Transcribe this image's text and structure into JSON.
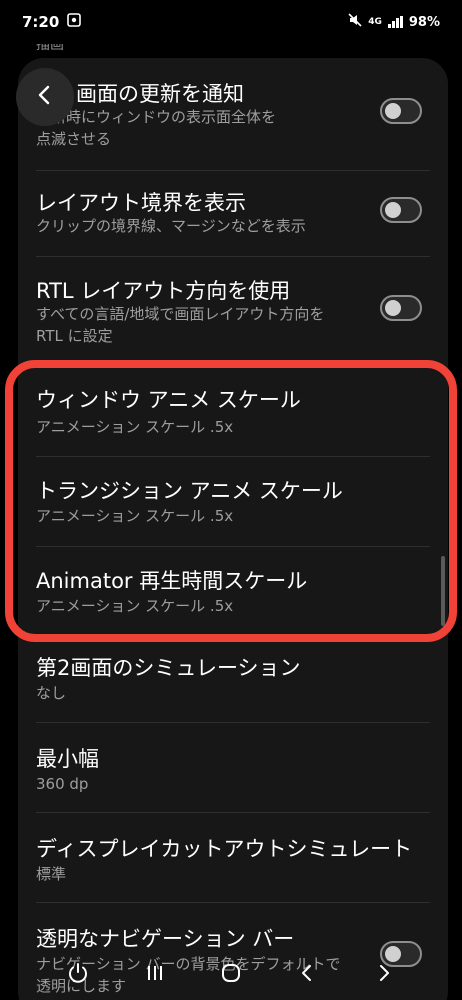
{
  "status_bar": {
    "time": "7:20",
    "network": "4G",
    "battery": "98%"
  },
  "section_label": "描画",
  "settings": [
    {
      "title": "画面の更新を通知",
      "subtitle_lines": [
        "更新時にウィンドウの表示面全体を",
        "点滅させる"
      ],
      "toggle": false
    },
    {
      "title": "レイアウト境界を表示",
      "subtitle_lines": [
        "クリップの境界線、マージンなどを表示"
      ],
      "toggle": false
    },
    {
      "title": "RTL レイアウト方向を使用",
      "subtitle_lines": [
        "すべての言語/地域で画面レイアウト方向を",
        "RTL に設定"
      ],
      "toggle": false
    },
    {
      "title": "ウィンドウ アニメ スケール",
      "subtitle_lines": [
        "アニメーション スケール .5x"
      ]
    },
    {
      "title": "トランジション アニメ スケール",
      "subtitle_lines": [
        "アニメーション スケール .5x"
      ]
    },
    {
      "title": "Animator 再生時間スケール",
      "subtitle_lines": [
        "アニメーション スケール .5x"
      ]
    },
    {
      "title": "第2画面のシミュレーション",
      "subtitle_lines": [
        "なし"
      ]
    },
    {
      "title": "最小幅",
      "subtitle_lines": [
        "360 dp"
      ]
    },
    {
      "title": "ディスプレイカットアウトシミュレート",
      "subtitle_lines": [
        "標準"
      ]
    },
    {
      "title": "透明なナビゲーション バー",
      "subtitle_lines": [
        "ナビゲーション バーの背景色をデフォルトで",
        "透明にします"
      ],
      "toggle": false
    }
  ],
  "colors": {
    "highlight": "#f04236",
    "card": "#171717",
    "background": "#000000"
  },
  "icons": {
    "back": "chevron-left-icon",
    "nav": [
      "power-icon",
      "recents-icon",
      "home-icon",
      "back-icon",
      "forward-icon"
    ]
  }
}
